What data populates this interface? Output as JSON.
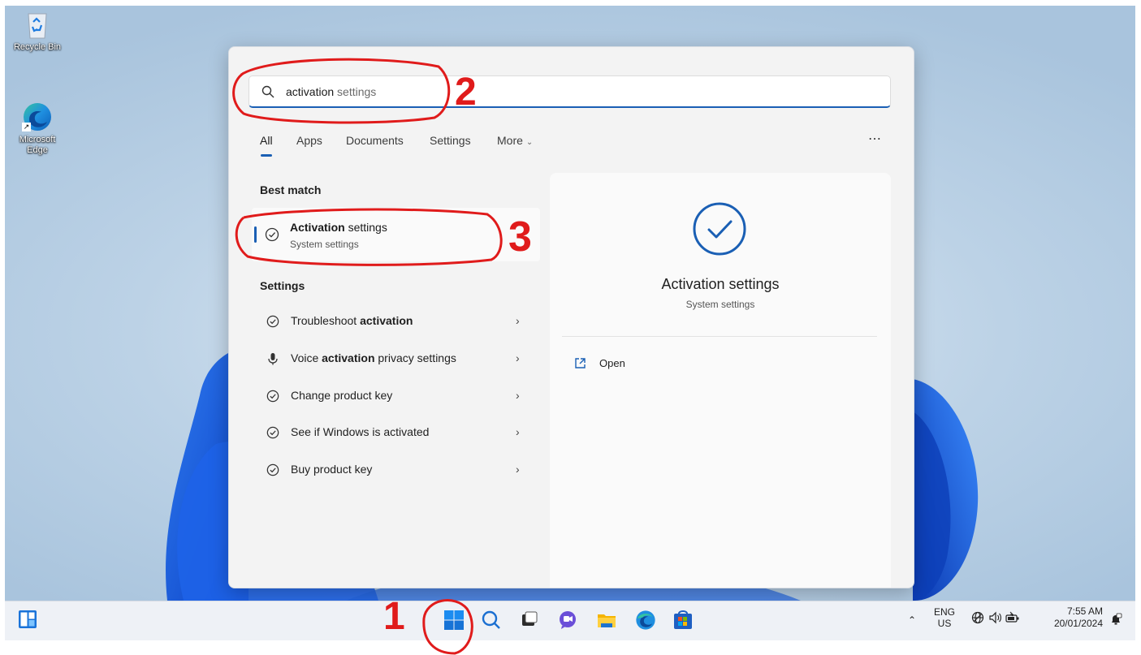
{
  "desktop": {
    "icons": [
      {
        "label": "Recycle Bin"
      },
      {
        "label_line1": "Microsoft",
        "label_line2": "Edge"
      }
    ]
  },
  "search": {
    "query_typed": "activation",
    "query_suggest": " settings"
  },
  "tabs": [
    "All",
    "Apps",
    "Documents",
    "Settings",
    "More"
  ],
  "sections": {
    "best_match": "Best match",
    "settings": "Settings"
  },
  "best_match": {
    "title_bold": "Activation",
    "title_rest": " settings",
    "subtitle": "System settings"
  },
  "settings_results": [
    {
      "pre": "Troubleshoot ",
      "bold": "activation",
      "post": "",
      "icon": "check-circle-icon"
    },
    {
      "pre": "Voice ",
      "bold": "activation",
      "post": " privacy settings",
      "icon": "microphone-icon"
    },
    {
      "pre": "Change product key",
      "bold": "",
      "post": "",
      "icon": "check-circle-icon"
    },
    {
      "pre": "See if Windows is activated",
      "bold": "",
      "post": "",
      "icon": "check-circle-icon"
    },
    {
      "pre": "Buy product key",
      "bold": "",
      "post": "",
      "icon": "check-circle-icon"
    }
  ],
  "preview": {
    "title": "Activation settings",
    "subtitle": "System settings",
    "action_open": "Open"
  },
  "tray": {
    "lang_line1": "ENG",
    "lang_line2": "US",
    "time": "7:55 AM",
    "date": "20/01/2024"
  },
  "annotations": [
    "1",
    "2",
    "3"
  ],
  "colors": {
    "accent": "#1a5fb4",
    "annotation": "#e01b1b"
  }
}
